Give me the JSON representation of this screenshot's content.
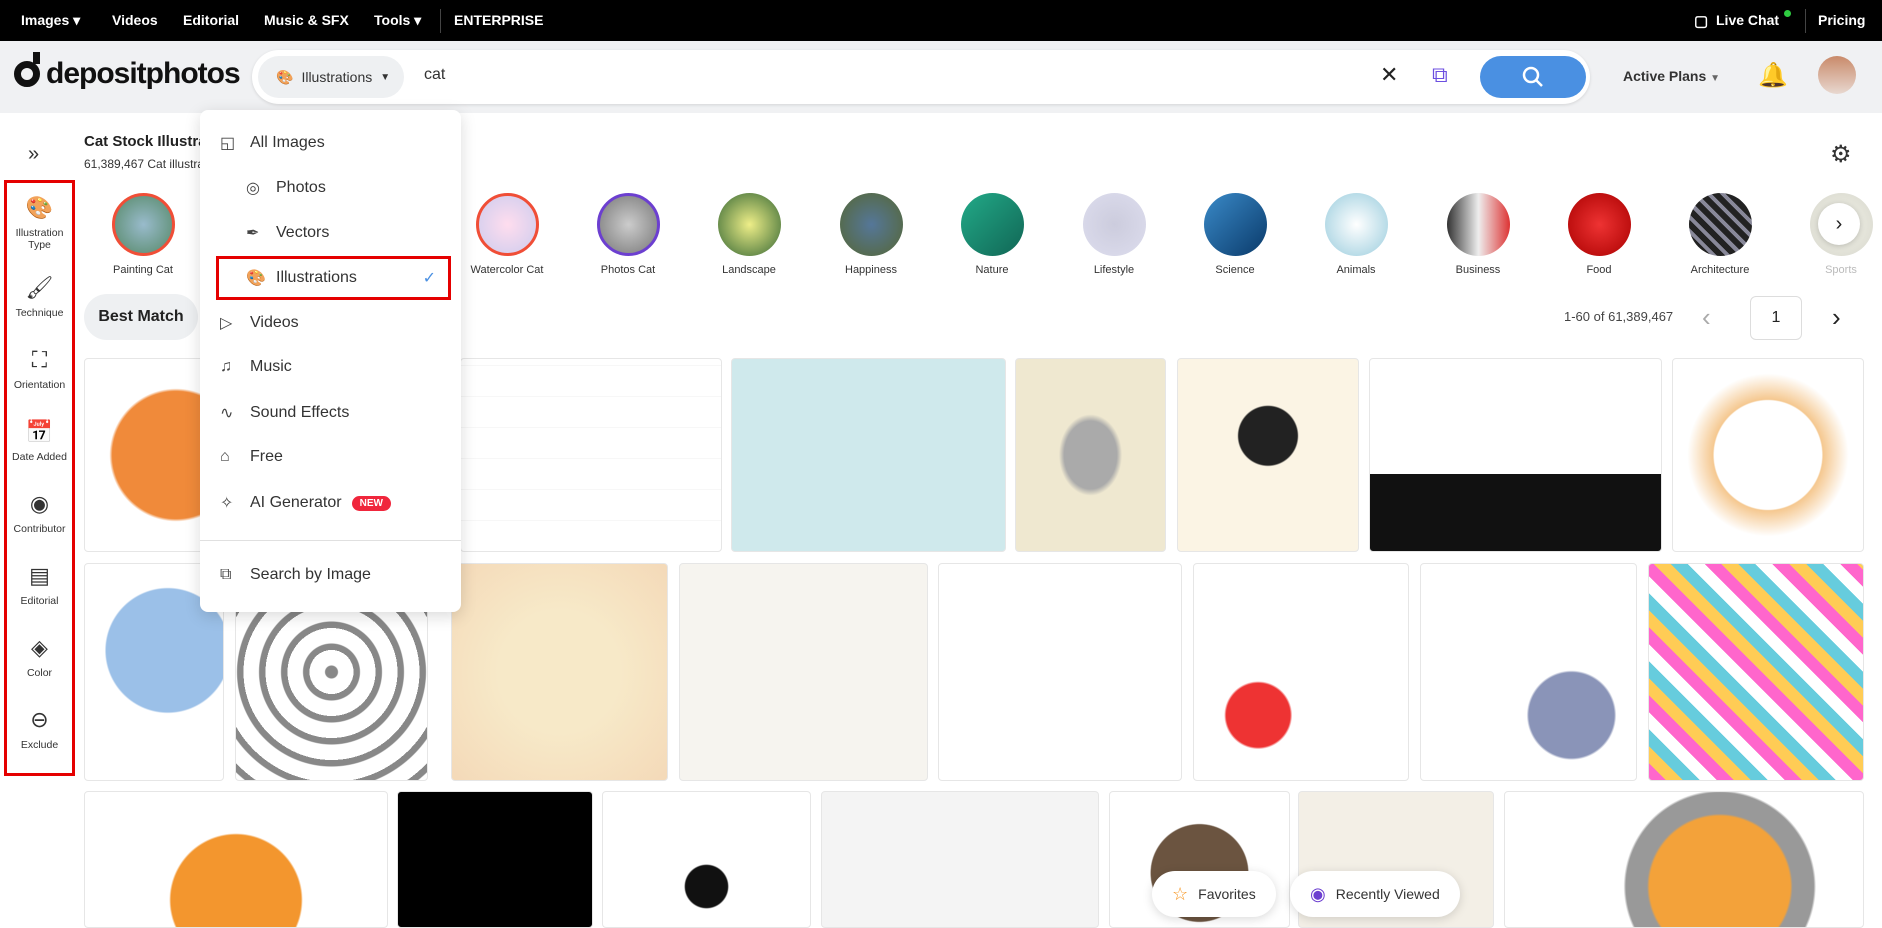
{
  "topnav": {
    "images": "Images ▾",
    "videos": "Videos",
    "editorial": "Editorial",
    "music": "Music & SFX",
    "tools": "Tools ▾",
    "enterprise": "ENTERPRISE",
    "live_chat": "Live Chat",
    "pricing": "Pricing"
  },
  "header": {
    "logo": "depositphotos",
    "type_selected": "Illustrations",
    "query": "cat",
    "active_plans": "Active Plans"
  },
  "page": {
    "title": "Cat Stock Illustrations",
    "subtitle": "61,389,467 Cat illustrations",
    "sort": "Best Match",
    "range": "1-60 of 61,389,467",
    "page_number": "1"
  },
  "sidebar": [
    {
      "label": "Illustration Type",
      "icon": "palette"
    },
    {
      "label": "Technique",
      "icon": "brush"
    },
    {
      "label": "Orientation",
      "icon": "frame"
    },
    {
      "label": "Date Added",
      "icon": "calendar"
    },
    {
      "label": "Contributor",
      "icon": "user-circle"
    },
    {
      "label": "Editorial",
      "icon": "newspaper"
    },
    {
      "label": "Color",
      "icon": "paint-bucket"
    },
    {
      "label": "Exclude",
      "icon": "tag-minus"
    }
  ],
  "categories": [
    "Painting Cat",
    "Watercolor Cat",
    "Photos Cat",
    "Landscape",
    "Happiness",
    "Nature",
    "Lifestyle",
    "Science",
    "Animals",
    "Business",
    "Food",
    "Architecture",
    "Sports"
  ],
  "dropdown": {
    "items": [
      "All Images",
      "Photos",
      "Vectors",
      "Illustrations",
      "Videos",
      "Music",
      "Sound Effects",
      "Free",
      "AI Generator"
    ],
    "new_badge": "NEW",
    "search_by_image": "Search by Image",
    "selected": "Illustrations"
  },
  "floating": {
    "favorites": "Favorites",
    "recently_viewed": "Recently Viewed"
  },
  "colors": {
    "accent": "#4a90e2",
    "highlight": "#e50000",
    "badge": "#f0263c"
  }
}
